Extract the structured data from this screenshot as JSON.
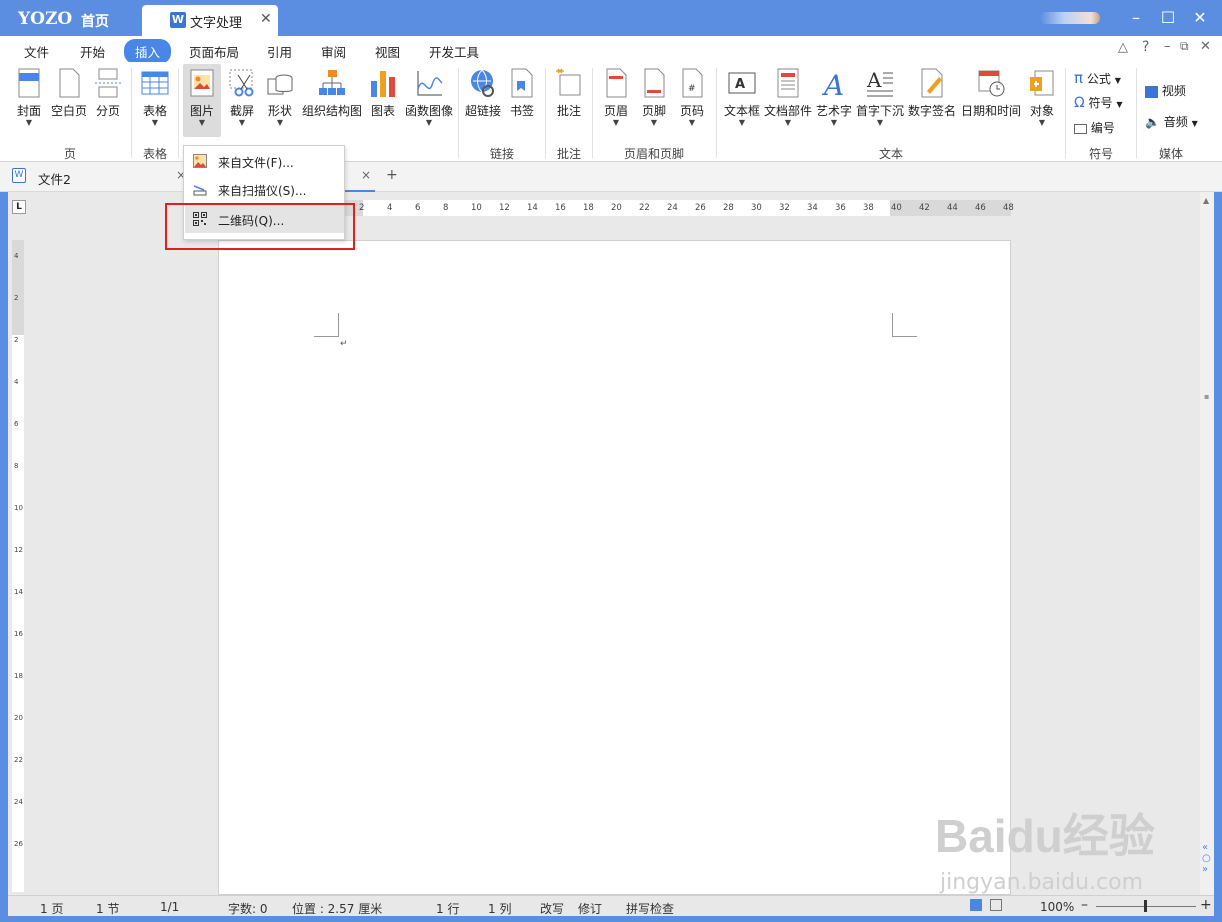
{
  "titlebar": {
    "logo": "YOZO",
    "home": "首页",
    "doc_tab": "文字处理",
    "doc_icon": "W"
  },
  "menus": [
    "文件",
    "开始",
    "插入",
    "页面布局",
    "引用",
    "审阅",
    "视图",
    "开发工具"
  ],
  "ribbon": {
    "buttons": [
      "封面",
      "空白页",
      "分页",
      "表格",
      "图片",
      "截屏",
      "形状",
      "组织结构图",
      "图表",
      "函数图像",
      "超链接",
      "书签",
      "批注",
      "页眉",
      "页脚",
      "页码",
      "文本框",
      "文档部件",
      "艺术字",
      "首字下沉",
      "数字签名",
      "日期和时间",
      "对象"
    ],
    "small": {
      "formula": "公式",
      "symbol": "符号",
      "numbering": "编号",
      "video": "视频",
      "audio": "音频"
    },
    "groups": [
      "页",
      "表格",
      "链接",
      "批注",
      "页眉和页脚",
      "文本",
      "符号",
      "媒体"
    ]
  },
  "doc_tab": {
    "name": "文件2",
    "close": "×",
    "add": "+"
  },
  "dropdown": {
    "items": [
      "来自文件(F)...",
      "来自扫描仪(S)...",
      "二维码(Q)..."
    ]
  },
  "ruler": {
    "h": [
      "2",
      "4",
      "6",
      "8",
      "10",
      "12",
      "14",
      "16",
      "18",
      "20",
      "22",
      "24",
      "26",
      "28",
      "30",
      "32",
      "34",
      "36",
      "38",
      "40",
      "42",
      "44",
      "46",
      "48"
    ],
    "v": [
      "4",
      "2",
      "2",
      "4",
      "6",
      "8",
      "10",
      "12",
      "14",
      "16",
      "18",
      "20",
      "22",
      "24",
      "26"
    ]
  },
  "status": {
    "page": "1 页",
    "section": "1 节",
    "pages": "1/1",
    "words": "字数: 0",
    "pos": "位置 : 2.57 厘米",
    "row": "1 行",
    "col": "1 列",
    "overwrite": "改写",
    "revise": "修订",
    "spell": "拼写检查",
    "zoom": "100%"
  },
  "watermark": "Baidu经验",
  "watermark_sub": "jingyan.baidu.com",
  "colors": {
    "accent": "#4a86e8",
    "title": "#5b8de0",
    "highlight": "#e02020"
  }
}
